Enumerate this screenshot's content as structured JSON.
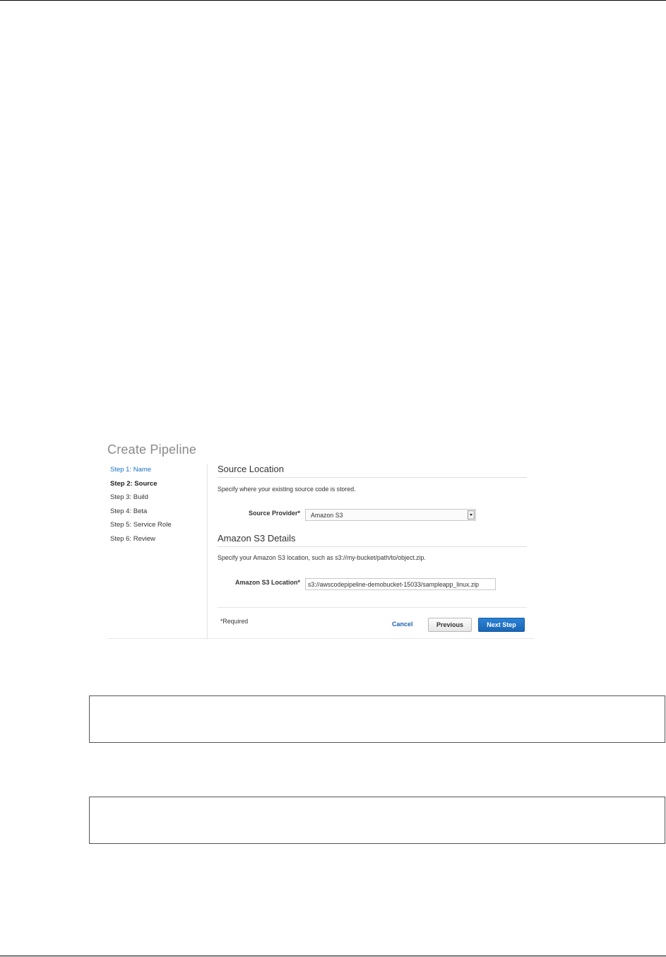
{
  "panel": {
    "title": "Create Pipeline",
    "steps": [
      {
        "label": "Step 1: Name"
      },
      {
        "label": "Step 2: Source"
      },
      {
        "label": "Step 3: Build"
      },
      {
        "label": "Step 4: Beta"
      },
      {
        "label": "Step 5: Service Role"
      },
      {
        "label": "Step 6: Review"
      }
    ],
    "source_location": {
      "title": "Source Location",
      "description": "Specify where your existing source code is stored.",
      "provider_label": "Source Provider*",
      "provider_value": "Amazon S3"
    },
    "s3_details": {
      "title": "Amazon S3 Details",
      "description": "Specify your Amazon S3 location, such as s3://my-bucket/path/to/object.zip.",
      "location_label": "Amazon S3 Location*",
      "location_value": "s3://awscodepipeline-demobucket-15033/sampleapp_linux.zip"
    },
    "footer": {
      "required_note": "*Required",
      "cancel_label": "Cancel",
      "previous_label": "Previous",
      "next_label": "Next Step"
    }
  },
  "colors": {
    "link": "#1a73c5",
    "primary_button": "#1a66b5",
    "title_gray": "#8a8a8a"
  }
}
